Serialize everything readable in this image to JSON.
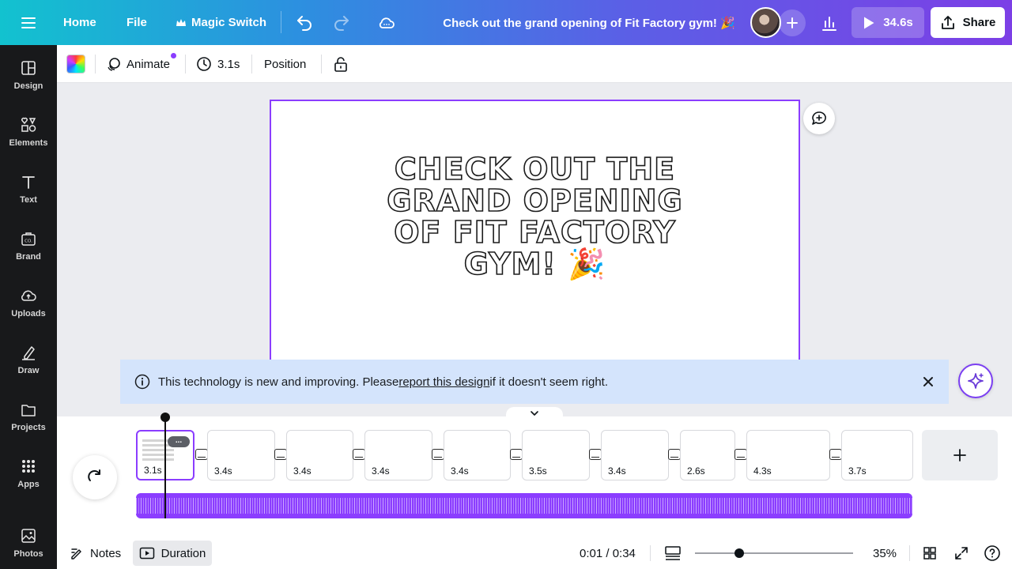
{
  "topbar": {
    "home": "Home",
    "file": "File",
    "magic_switch": "Magic Switch",
    "doc_title": "Check out the grand opening of Fit Factory gym! 🎉",
    "play_duration": "34.6s",
    "share": "Share"
  },
  "sidebar": {
    "items": [
      {
        "label": "Design",
        "icon": "design-icon"
      },
      {
        "label": "Elements",
        "icon": "elements-icon"
      },
      {
        "label": "Text",
        "icon": "text-icon"
      },
      {
        "label": "Brand",
        "icon": "brand-icon"
      },
      {
        "label": "Uploads",
        "icon": "uploads-icon"
      },
      {
        "label": "Draw",
        "icon": "draw-icon"
      },
      {
        "label": "Projects",
        "icon": "projects-icon"
      },
      {
        "label": "Apps",
        "icon": "apps-icon"
      },
      {
        "label": "Photos",
        "icon": "photos-icon"
      }
    ]
  },
  "toolbar": {
    "animate": "Animate",
    "duration": "3.1s",
    "position": "Position"
  },
  "canvas": {
    "headline_lines": [
      "CHECK OUT THE",
      "GRAND OPENING",
      "OF FIT FACTORY",
      "GYM! 🎉"
    ]
  },
  "banner": {
    "text_before": "This technology is new and improving. Please ",
    "link": "report this design",
    "text_after": " if it doesn't seem right."
  },
  "timeline": {
    "pages": [
      {
        "duration": "3.1s",
        "active": true
      },
      {
        "duration": "3.4s"
      },
      {
        "duration": "3.4s"
      },
      {
        "duration": "3.4s"
      },
      {
        "duration": "3.4s"
      },
      {
        "duration": "3.5s"
      },
      {
        "duration": "3.4s"
      },
      {
        "duration": "2.6s"
      },
      {
        "duration": "4.3s"
      },
      {
        "duration": "3.7s"
      }
    ],
    "more_label": "..."
  },
  "bottombar": {
    "notes": "Notes",
    "duration": "Duration",
    "time": "0:01 / 0:34",
    "zoom": "35%",
    "zoom_fraction": 0.28
  },
  "colors": {
    "accent": "#8b3dff",
    "banner": "#d4e4fc",
    "sidebar": "#18191b"
  }
}
